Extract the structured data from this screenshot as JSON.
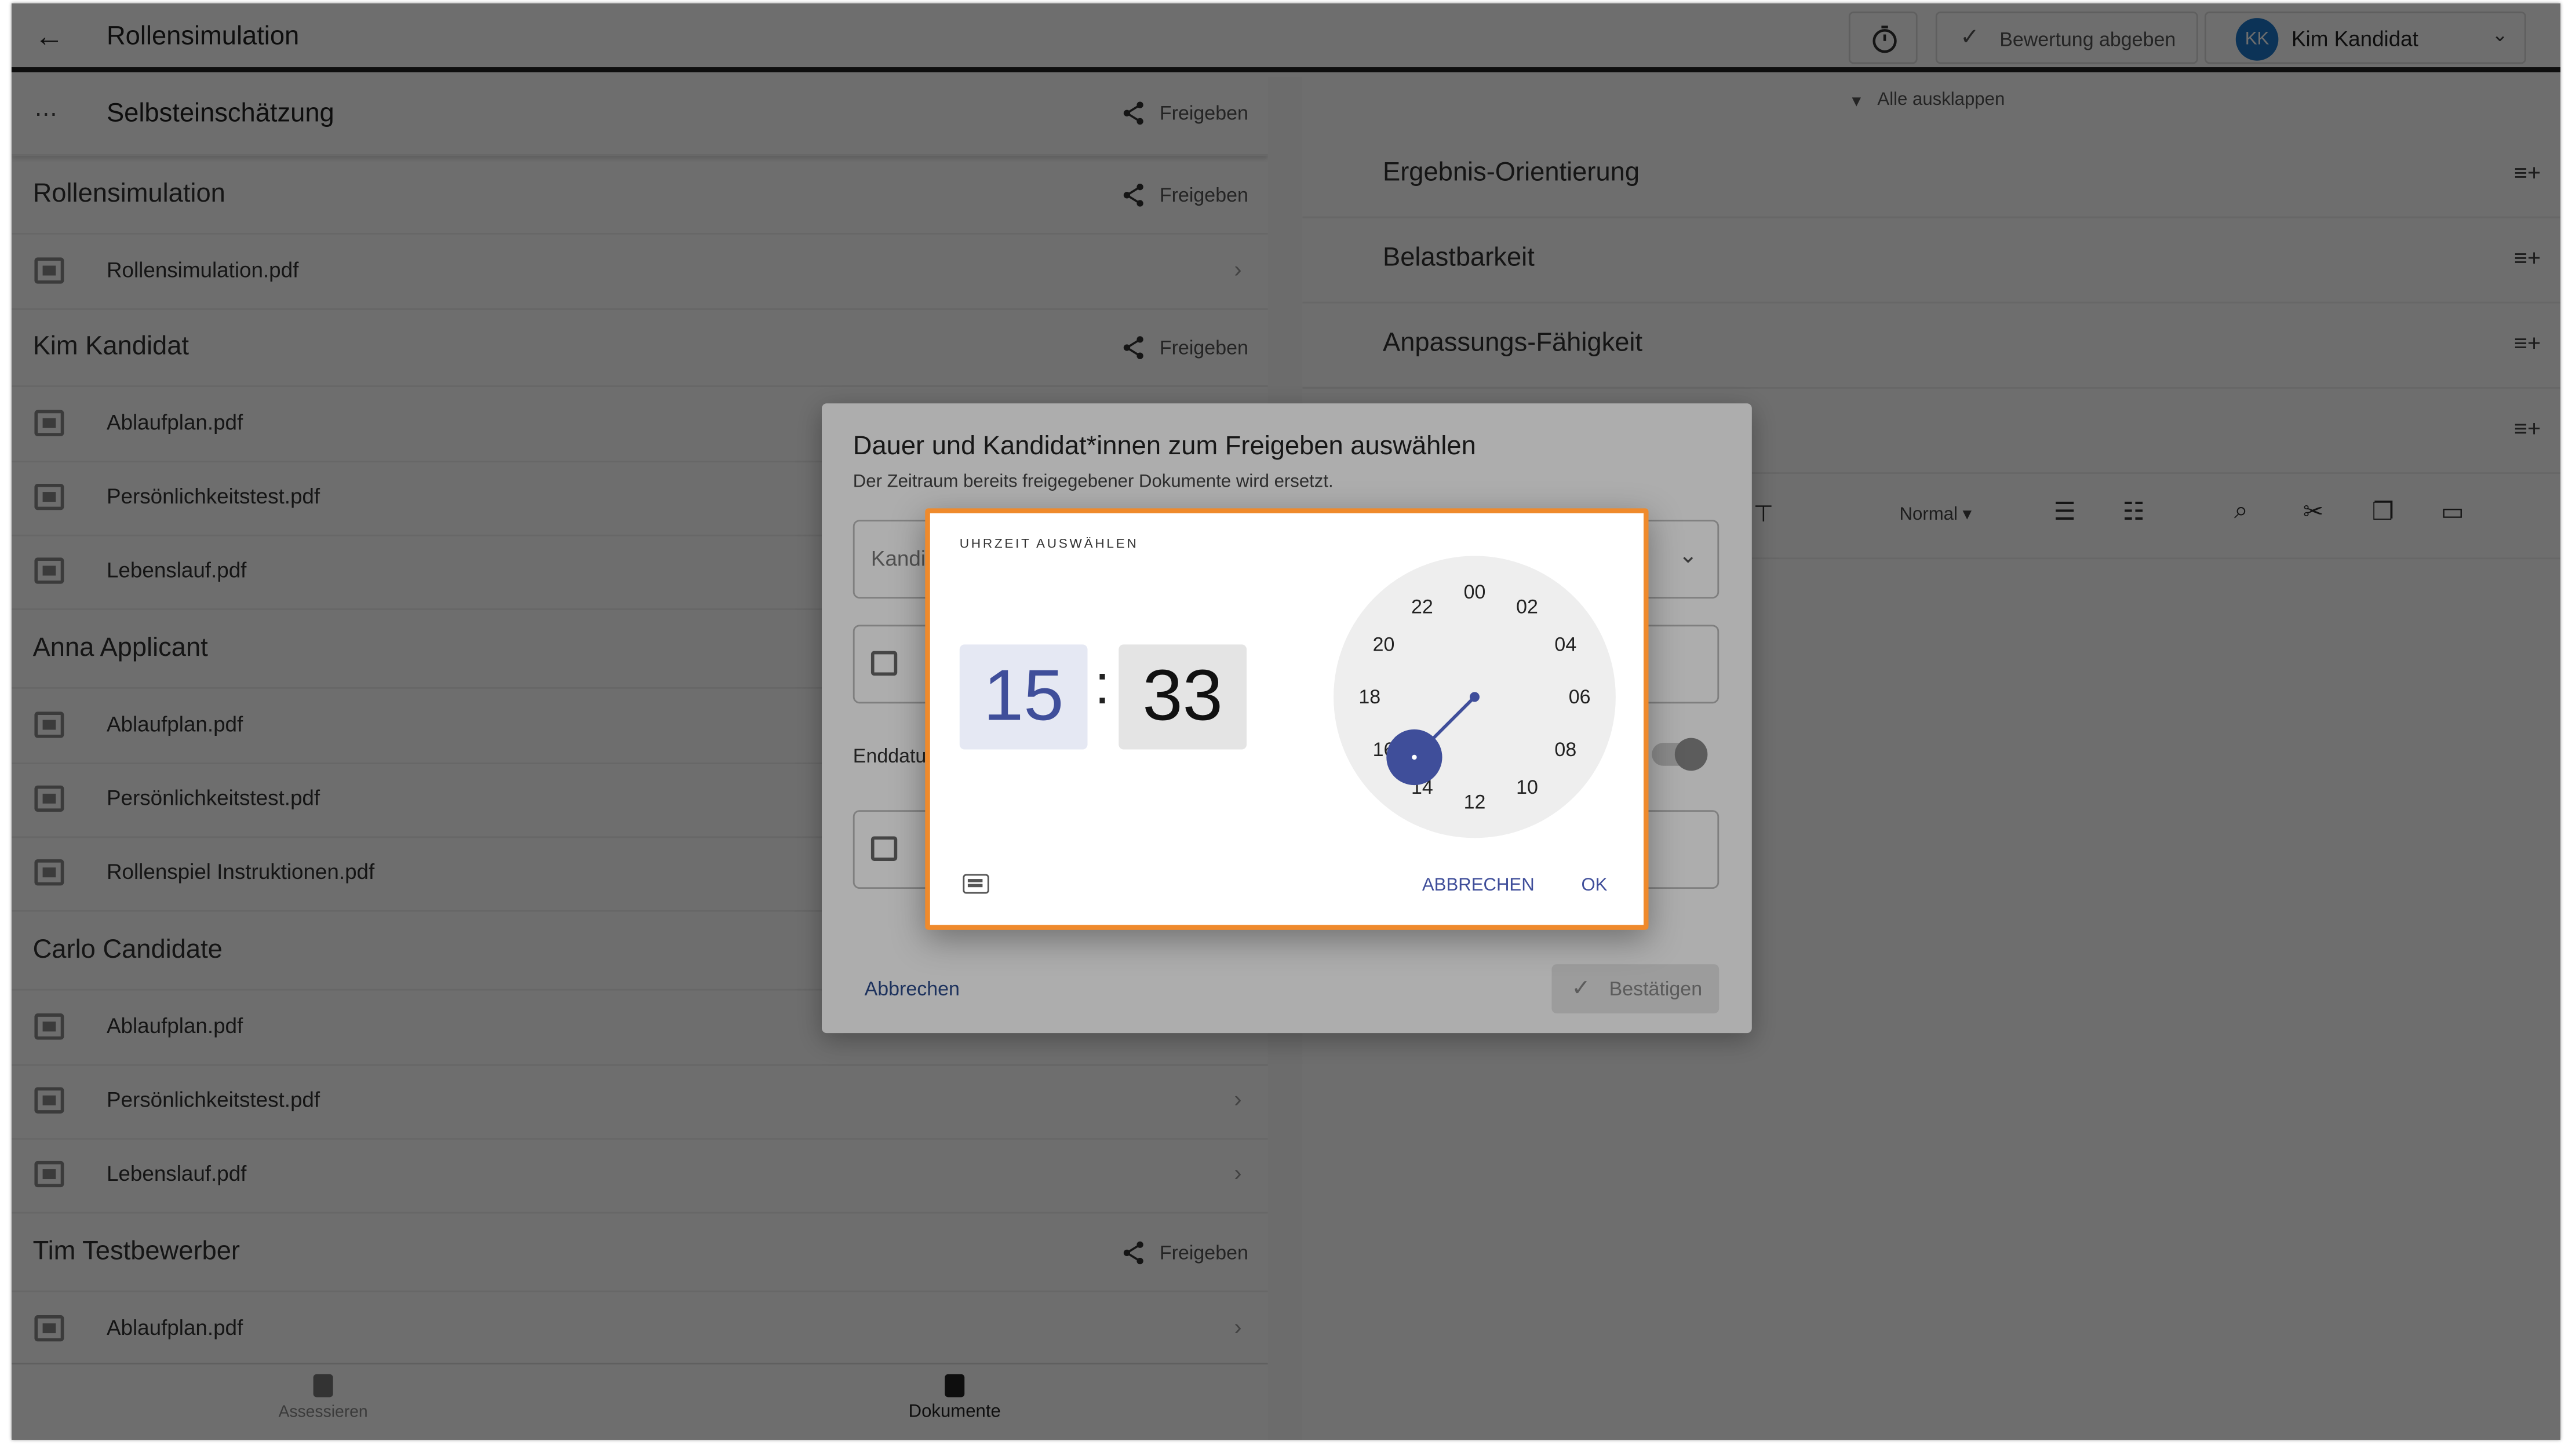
{
  "header": {
    "back_label": "←",
    "title": "Rollensimulation",
    "submit_rating": "Bewertung abgeben",
    "user_initials": "KK",
    "user_name": "Kim Kandidat"
  },
  "left": {
    "self_assessment": "Selbsteinschätzung",
    "share_label": "Freigeben",
    "groups": [
      {
        "title": "Rollensimulation",
        "files": [
          "Rollensimulation.pdf"
        ]
      },
      {
        "title": "Kim Kandidat",
        "files": [
          "Ablaufplan.pdf",
          "Persönlichkeitstest.pdf",
          "Lebenslauf.pdf"
        ]
      },
      {
        "title": "Anna Applicant",
        "files": [
          "Ablaufplan.pdf",
          "Persönlichkeitstest.pdf",
          "Rollenspiel Instruktionen.pdf"
        ]
      },
      {
        "title": "Carlo Candidate",
        "files": [
          "Ablaufplan.pdf",
          "Persönlichkeitstest.pdf",
          "Lebenslauf.pdf"
        ]
      },
      {
        "title": "Tim Testbewerber",
        "files": [
          "Ablaufplan.pdf"
        ]
      }
    ]
  },
  "bottom_nav": {
    "assess": "Assessieren",
    "docs": "Dokumente"
  },
  "right": {
    "expand_all": "Alle ausklappen",
    "accordions": [
      "Ergebnis-Orientierung",
      "Belastbarkeit",
      "Anpassungs-Fähigkeit"
    ],
    "toolbar_style": "Normal"
  },
  "dialog": {
    "title": "Dauer und Kandidat*innen zum Freigeben auswählen",
    "subtitle": "Der Zeitraum bereits freigegebener Dokumente wird ersetzt.",
    "candidates_placeholder": "Kandi",
    "end_date_label": "Enddatu",
    "cancel": "Abbrechen",
    "confirm": "Bestätigen"
  },
  "time_picker": {
    "heading": "UHRZEIT AUSWÄHLEN",
    "hour": "15",
    "separator": ":",
    "minute": "33",
    "dial_labels": [
      "00",
      "02",
      "04",
      "06",
      "08",
      "10",
      "12",
      "14",
      "16",
      "18",
      "20",
      "22"
    ],
    "selected_hour": 15,
    "cancel": "ABBRECHEN",
    "ok": "OK",
    "accent_color": "#3f4e9a"
  }
}
